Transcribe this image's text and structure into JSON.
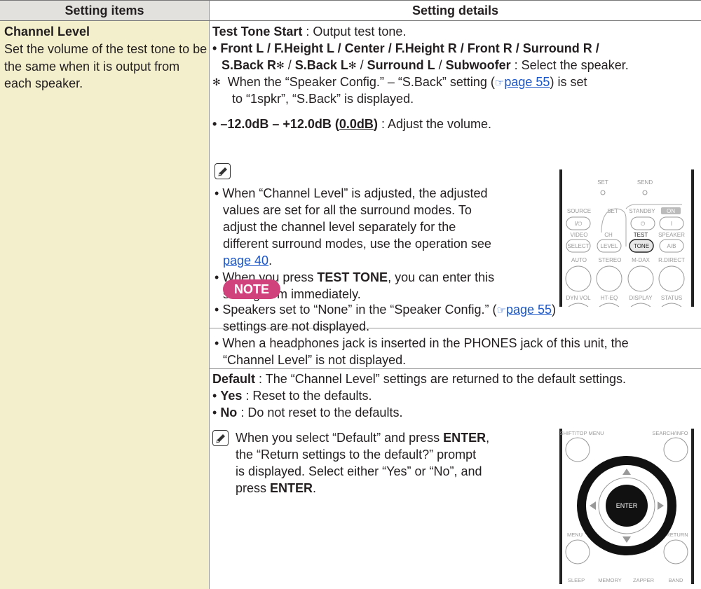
{
  "header": {
    "left": "Setting items",
    "right": "Setting details"
  },
  "left": {
    "title": "Channel Level",
    "desc": "Set the volume of the test tone to be the same when it is output from each speaker."
  },
  "right": {
    "test_tone_label": "Test Tone Start",
    "test_tone_text": " : Output test tone.",
    "speakers_line1": [
      "Front L",
      "F.Height L",
      "Center",
      "F.Height R",
      "Front R",
      "Surround R"
    ],
    "speakers_line2": [
      "S.Back R",
      "S.Back L",
      "Surround L",
      "Subwoofer"
    ],
    "select_text": " : Select the speaker.",
    "asterisk": "✻",
    "footnote_line1_a": "When the “Speaker Config.” – “S.Back” setting (",
    "footnote_link": "page 55",
    "footnote_line1_b": ") is set",
    "footnote_line2": "to “1spkr”, “S.Back” is displayed.",
    "range_label": "–12.0dB – +12.0dB (",
    "range_default": "0.0dB",
    "range_close": ")",
    "range_text": " : Adjust the volume.",
    "tip1_lines": [
      "When “Channel Level” is adjusted, the adjusted",
      "values are set for all the surround modes. To",
      "adjust the channel level separately for the",
      "different surround modes, use the operation see"
    ],
    "tip1_link": "page 40",
    "tip1_link_end": ".",
    "tip2_a": "When you press ",
    "tip2_bold": "TEST TONE",
    "tip2_b": ", you can enter this",
    "tip2_line2": "setting item immediately.",
    "note_label": "NOTE",
    "note1_a": "Speakers set to “None” in the “Speaker Config.” (",
    "note1_link": "page 55",
    "note1_b": ")",
    "note1_line2": "settings are not displayed.",
    "note2_line1": "When a headphones jack is inserted in the PHONES jack of this unit, the",
    "note2_line2": "“Channel Level” is not displayed.",
    "default_label": "Default",
    "default_text": " : The “Channel Level” settings are returned to the default settings.",
    "yes_label": "Yes",
    "yes_text": " : Reset to the defaults.",
    "no_label": "No",
    "no_text": " : Do not reset to the defaults.",
    "tip3_a": "When you select “Default” and press ",
    "tip3_bold1": "ENTER",
    "tip3_b": ",",
    "tip3_line2": "the “Return settings to the default?” prompt",
    "tip3_line3": "is displayed. Select either “Yes” or “No”, and",
    "tip3_c": "press ",
    "tip3_bold2": "ENTER",
    "tip3_d": "."
  },
  "remote1": {
    "labels": [
      "SET",
      "SEND",
      "SOURCE",
      "SET",
      "STANDBY",
      "ON",
      "VIDEO",
      "CH",
      "TEST",
      "SPEAKER",
      "AUTO",
      "STEREO",
      "M-DAX",
      "R.DIRECT",
      "DYN VOL",
      "HT-EQ",
      "DISPLAY",
      "STATUS"
    ],
    "buttons": [
      "I/⏻",
      "⏻",
      "I",
      "SELECT",
      "LEVEL",
      "TONE",
      "A/B"
    ]
  },
  "remote2": {
    "labels": [
      "SHIFT/TOP MENU",
      "SEARCH/INFO",
      "MENU",
      "RETURN",
      "SLEEP",
      "MEMORY",
      "ZAPPER",
      "BAND"
    ],
    "center": "ENTER"
  }
}
